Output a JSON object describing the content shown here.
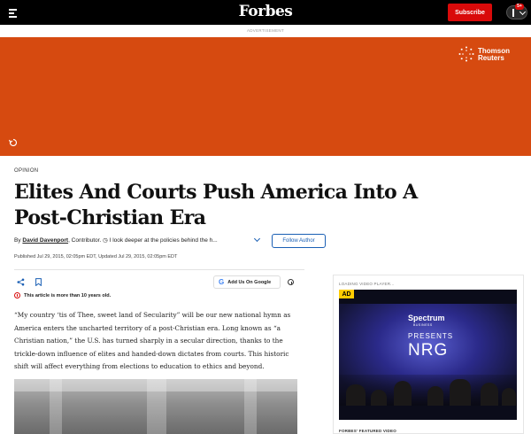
{
  "nav": {
    "logo": "Forbes",
    "subscribe_label": "Subscribe",
    "notification_count": "5+"
  },
  "ad": {
    "label": "ADVERTISEMENT",
    "banner_color": "#d64a10",
    "brand_line1": "Thomson",
    "brand_line2": "Reuters"
  },
  "article": {
    "category": "OPINION",
    "headline": "Elites And Courts Push America Into A Post-Christian Era",
    "byline_prefix": "By",
    "author": "David Davenport",
    "author_role": ", Contributor.",
    "author_tagline": "I look deeper at the policies behind the h...",
    "follow_label": "Follow Author",
    "dates": "Published Jul 29, 2015, 02:05pm EDT, Updated Jul 29, 2015, 02:05pm EDT",
    "add_google_label": "Add Us On Google",
    "age_notice": "This article is more than 10 years old.",
    "body": "“My country ‘tis of Thee, sweet land of Secularity” will be our new national hymn as America enters the uncharted territory of a post-Christian era.  Long known as “a Christian nation,” the U.S. has turned sharply in a secular direction, thanks to the trickle-down influence of elites and handed-down dictates from courts.  This historic shift will affect everything from elections to education to ethics and beyond."
  },
  "video": {
    "loading_label": "LOADING VIDEO PLAYER...",
    "ad_badge": "AD",
    "brand": "Spectrum",
    "brand_sub": "BUSINESS",
    "presents": "PRESENTS",
    "title": "NRG",
    "footer_label": "FORBES' FEATURED VIDEO"
  },
  "colors": {
    "accent_red": "#d90a0a",
    "link_blue": "#1a5fb4"
  }
}
